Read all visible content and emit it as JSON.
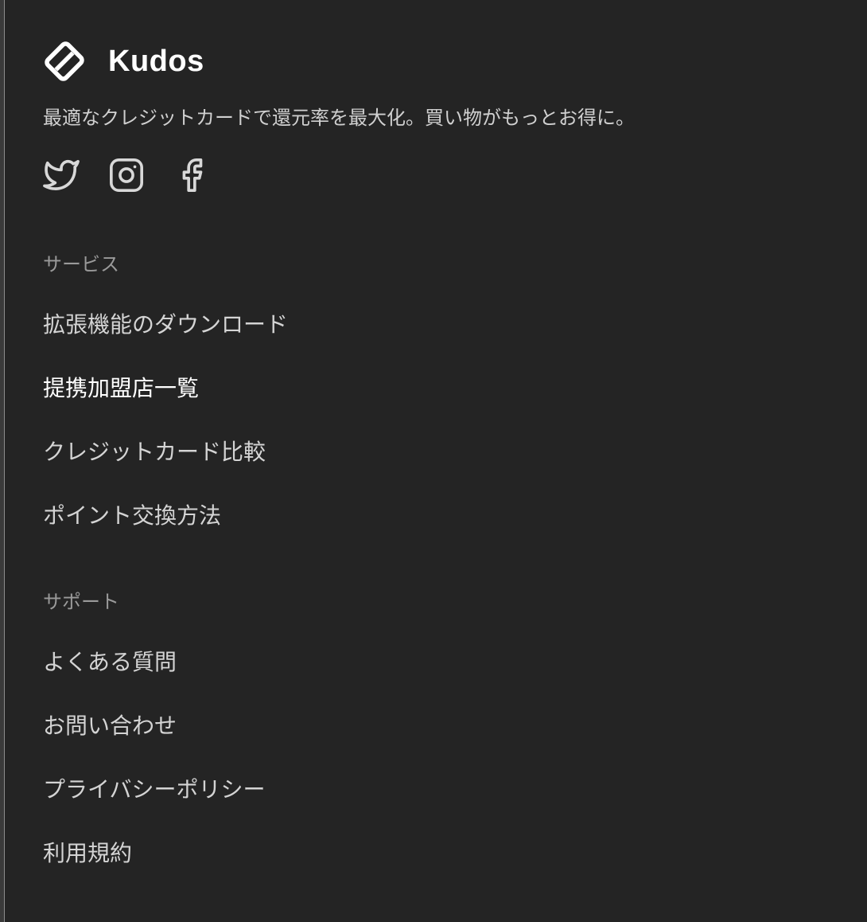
{
  "brand": {
    "name": "Kudos",
    "tagline": "最適なクレジットカードで還元率を最大化。買い物がもっとお得に。",
    "logo_icon": "kudos-card-logo"
  },
  "social": [
    {
      "icon": "twitter-icon"
    },
    {
      "icon": "instagram-icon"
    },
    {
      "icon": "facebook-icon"
    }
  ],
  "services": {
    "title": "サービス",
    "links": [
      {
        "label": "拡張機能のダウンロード"
      },
      {
        "label": "提携加盟店一覧"
      },
      {
        "label": "クレジットカード比較"
      },
      {
        "label": "ポイント交換方法"
      }
    ]
  },
  "support": {
    "title": "サポート",
    "links": [
      {
        "label": "よくある質問"
      },
      {
        "label": "お問い合わせ"
      },
      {
        "label": "プライバシーポリシー"
      },
      {
        "label": "利用規約"
      }
    ]
  },
  "colors": {
    "background": "#242424",
    "text": "#d4d4d4",
    "muted": "#9a9a9a",
    "highlight": "#ffffff"
  }
}
